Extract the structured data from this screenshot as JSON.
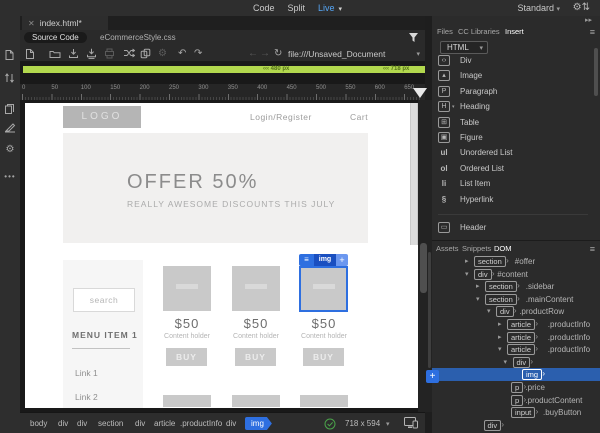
{
  "app": {
    "view_modes": [
      "Code",
      "Split",
      "Live"
    ],
    "active_view": "Live",
    "workspace": "Standard"
  },
  "document": {
    "tab_title": "index.html*",
    "related_files": [
      "Source Code",
      "eCommerceStyle.css"
    ],
    "url": "file:///Unsaved_Document"
  },
  "media_bar": {
    "markers": [
      "480 px",
      "718 px"
    ]
  },
  "ruler_numbers": [
    "0",
    "50",
    "100",
    "150",
    "200",
    "250",
    "300",
    "350",
    "400",
    "450",
    "500",
    "550",
    "600",
    "650"
  ],
  "preview": {
    "logo": "LOGO",
    "nav": [
      "Login/Register",
      "Cart"
    ],
    "banner_title": "OFFER 50%",
    "banner_subtitle": "REALLY AWESOME DISCOUNTS THIS JULY",
    "search_placeholder": "search",
    "menu_title": "MENU ITEM 1",
    "menu_links": [
      "Link 1",
      "Link 2"
    ],
    "products": [
      {
        "price": "$50",
        "caption": "Content holder",
        "button": "BUY"
      },
      {
        "price": "$50",
        "caption": "Content holder",
        "button": "BUY"
      },
      {
        "price": "$50",
        "caption": "Content holder",
        "button": "BUY"
      }
    ],
    "selected_element_label": "img"
  },
  "insert_panel": {
    "tabs": [
      "Files",
      "CC Libraries",
      "Insert"
    ],
    "active_tab": "Insert",
    "category": "HTML",
    "items": [
      {
        "icon": "div",
        "glyph": "‹›",
        "label": "Div"
      },
      {
        "icon": "image",
        "glyph": "▴",
        "label": "Image"
      },
      {
        "icon": "paragraph",
        "glyph": "P",
        "label": "Paragraph"
      },
      {
        "icon": "heading",
        "glyph": "H",
        "label": "Heading",
        "dropdown": true
      },
      {
        "icon": "table",
        "glyph": "⊞",
        "label": "Table"
      },
      {
        "icon": "figure",
        "glyph": "▣",
        "label": "Figure"
      },
      {
        "icon": "unordered-list",
        "glyph": "ul",
        "label": "Unordered List",
        "text": true
      },
      {
        "icon": "ordered-list",
        "glyph": "ol",
        "label": "Ordered List",
        "text": true
      },
      {
        "icon": "list-item",
        "glyph": "li",
        "label": "List Item",
        "text": true
      },
      {
        "icon": "hyperlink",
        "glyph": "§",
        "label": "Hyperlink",
        "text": true
      }
    ],
    "more_items": [
      {
        "icon": "header",
        "glyph": "▭",
        "label": "Header"
      }
    ]
  },
  "dom_panel": {
    "tabs": [
      "Assets",
      "Snippets",
      "DOM"
    ],
    "active_tab": "DOM",
    "rows": [
      {
        "level": 0,
        "arrow": "collapsed",
        "tag": "section",
        "label": "#offer"
      },
      {
        "level": 0,
        "arrow": "expanded",
        "tag": "div",
        "label": "#content"
      },
      {
        "level": 1,
        "arrow": "collapsed",
        "tag": "section",
        "label": ".sidebar"
      },
      {
        "level": 1,
        "arrow": "expanded",
        "tag": "section",
        "label": ".mainContent"
      },
      {
        "level": 2,
        "arrow": "expanded",
        "tag": "div",
        "label": ".productRow"
      },
      {
        "level": 3,
        "arrow": "collapsed",
        "tag": "article",
        "label": ".productInfo"
      },
      {
        "level": 3,
        "arrow": "collapsed",
        "tag": "article",
        "label": ".productInfo"
      },
      {
        "level": 3,
        "arrow": "expanded",
        "tag": "article",
        "label": ".productInfo"
      },
      {
        "level": 3.5,
        "arrow": "expanded",
        "tag": "div",
        "label": ""
      },
      {
        "level": 5,
        "arrow": "none",
        "tag": "img",
        "label": "",
        "selected": true
      },
      {
        "level": 4,
        "arrow": "none",
        "tag": "p",
        "label": ".price"
      },
      {
        "level": 4,
        "arrow": "none",
        "tag": "p",
        "label": ".productContent"
      },
      {
        "level": 4,
        "arrow": "none",
        "tag": "input",
        "label": ".buyButton"
      },
      {
        "level": 1.5,
        "arrow": "none",
        "tag": "div",
        "label": ""
      }
    ]
  },
  "status_bar": {
    "path": [
      "body",
      "div",
      "div",
      "section",
      "div",
      "article",
      ".productInfo",
      "div"
    ],
    "selected_tag": "img",
    "window_size": "718 x 594"
  }
}
